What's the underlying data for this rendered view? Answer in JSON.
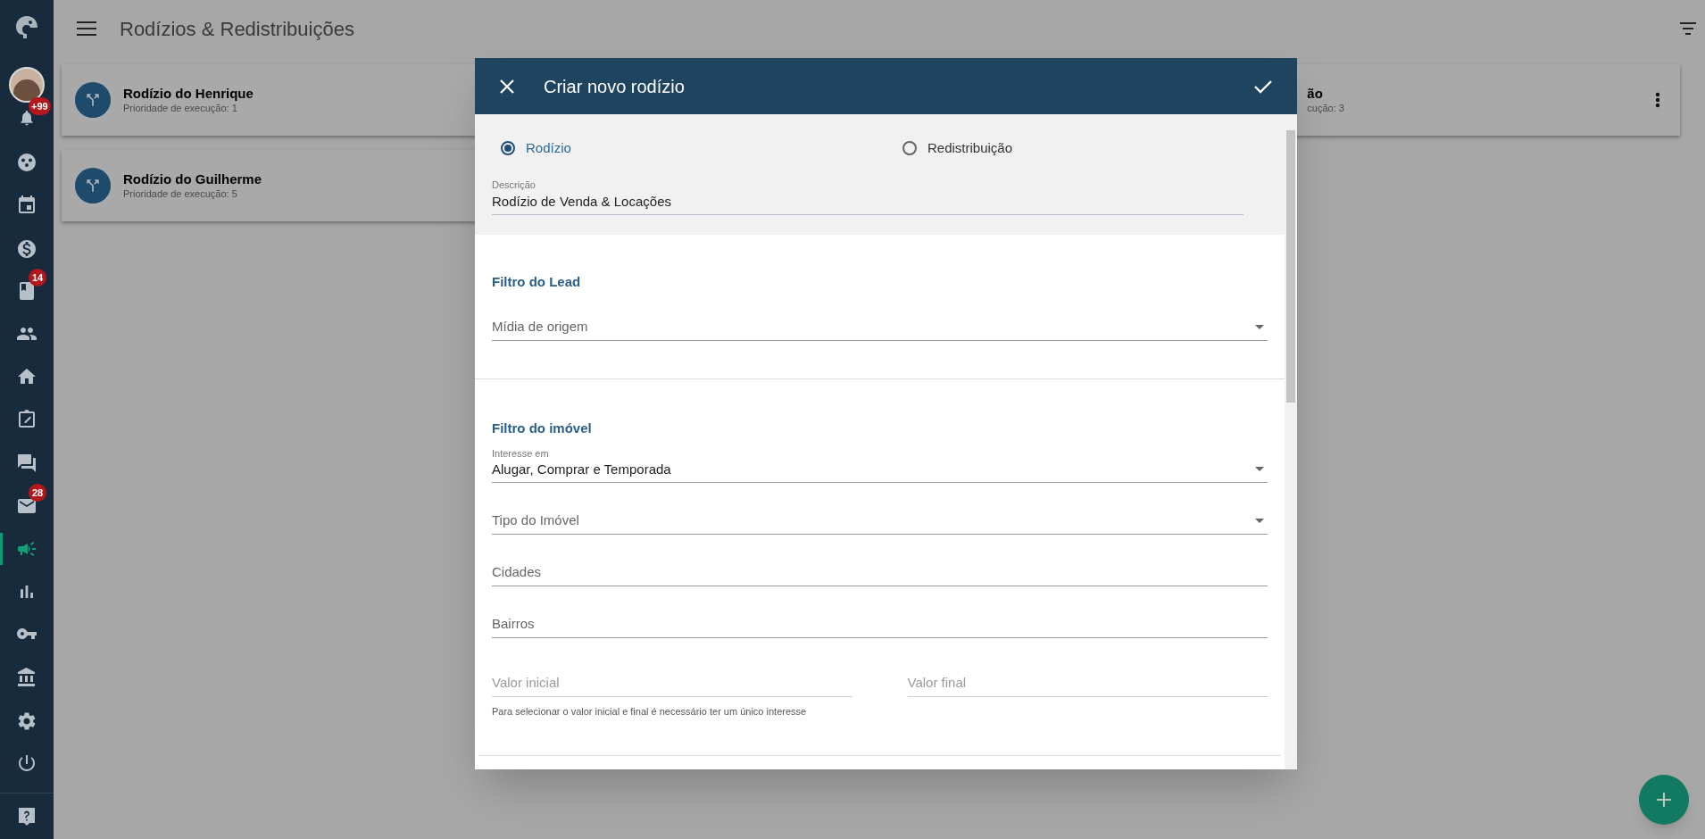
{
  "sidebar": {
    "items": [
      {
        "selected": false
      },
      {
        "selected": false
      },
      {
        "selected": false,
        "badge": "+99"
      },
      {
        "selected": false
      },
      {
        "selected": false
      },
      {
        "selected": false
      },
      {
        "selected": false,
        "badge": "14"
      },
      {
        "selected": false
      },
      {
        "selected": false
      },
      {
        "selected": false
      },
      {
        "selected": false
      },
      {
        "selected": false,
        "badge": "28"
      },
      {
        "selected": true
      },
      {
        "selected": false
      },
      {
        "selected": false
      },
      {
        "selected": false
      },
      {
        "selected": false
      },
      {
        "selected": false
      },
      {
        "selected": false
      }
    ]
  },
  "header": {
    "title": "Rodízios & Redistribuições"
  },
  "cards": [
    {
      "title": "Rodízio do Henrique",
      "subtitle": "Prioridade de execução: 1"
    },
    {
      "title": "Rodízio do Guilherme",
      "subtitle": "Prioridade de execução: 5"
    },
    {
      "title": "ão",
      "subtitle": "cução: 3",
      "partial": true
    }
  ],
  "dialog": {
    "title": "Criar novo rodízio",
    "radios": [
      {
        "label": "Rodízio",
        "selected": true
      },
      {
        "label": "Redistribuição",
        "selected": false
      }
    ],
    "description": {
      "label": "Descrição",
      "value": "Rodízio de Venda & Locações"
    },
    "sections": [
      {
        "title": "Filtro do Lead",
        "fields": [
          {
            "kind": "select",
            "placeholder": "Mídia de origem"
          }
        ]
      },
      {
        "title": "Filtro do imóvel",
        "fields": [
          {
            "kind": "select",
            "label": "Interesse em",
            "value": "Alugar, Comprar e Temporada"
          },
          {
            "kind": "select",
            "placeholder": "Tipo do Imóvel"
          },
          {
            "kind": "text",
            "placeholder": "Cidades"
          },
          {
            "kind": "text",
            "placeholder": "Bairros"
          },
          {
            "kind": "pair",
            "fields": [
              {
                "placeholder": "Valor inicial",
                "disabled": true
              },
              {
                "placeholder": "Valor final",
                "disabled": true
              }
            ],
            "hint": "Para selecionar o valor inicial e final é necessário ter um único interesse"
          }
        ]
      }
    ]
  }
}
